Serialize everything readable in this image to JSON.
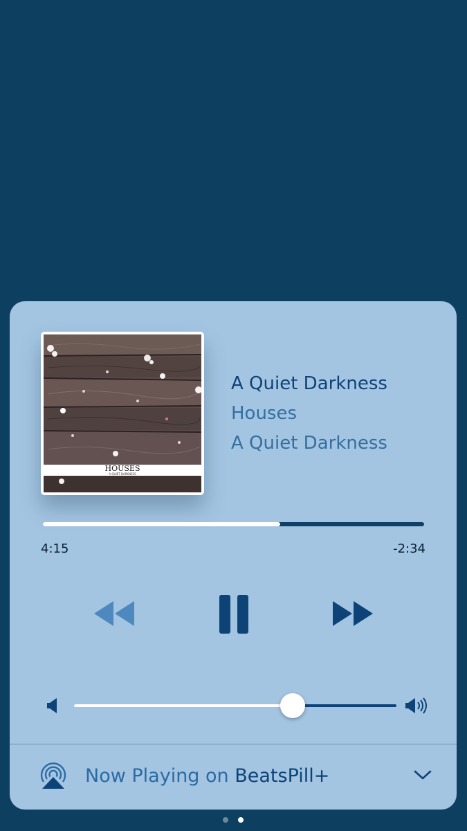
{
  "now_playing": {
    "song_title": "A Quiet Darkness",
    "artist": "Houses",
    "album": "A Quiet Darkness",
    "artwork": {
      "title": "HOUSES",
      "subtitle": "A QUIET DARKNESS"
    },
    "progress": {
      "elapsed": "4:15",
      "remaining": "-2:34",
      "fraction": 0.623
    },
    "volume": {
      "fraction": 0.679
    },
    "controls": {
      "rewind": "rewind-icon",
      "pause": "pause-icon",
      "forward": "fast-forward-icon"
    }
  },
  "airplay": {
    "prefix": "Now Playing on ",
    "device": "BeatsPill+",
    "icon": "airplay-icon"
  },
  "page_indicator": {
    "count": 2,
    "active": 2
  },
  "colors": {
    "background": "#0d4060",
    "card": "#a3c5e2",
    "accent_dark": "#0e4378",
    "accent_mid": "#356f9f",
    "rewind_disabled": "#4d88bf"
  }
}
